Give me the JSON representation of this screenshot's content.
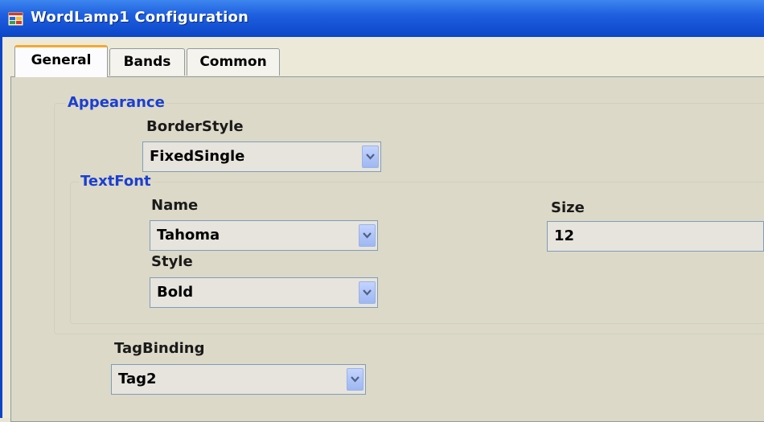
{
  "window": {
    "title": "WordLamp1 Configuration",
    "icon": "app-window-icon"
  },
  "tabs": [
    {
      "label": "General",
      "active": true
    },
    {
      "label": "Bands",
      "active": false
    },
    {
      "label": "Common",
      "active": false
    }
  ],
  "appearance": {
    "legend": "Appearance",
    "border_style": {
      "label": "BorderStyle",
      "value": "FixedSingle"
    },
    "text_font": {
      "legend": "TextFont",
      "name": {
        "label": "Name",
        "value": "Tahoma"
      },
      "size": {
        "label": "Size",
        "value": "12"
      },
      "style": {
        "label": "Style",
        "value": "Bold"
      }
    }
  },
  "tag_binding": {
    "label": "TagBinding",
    "value": "Tag2"
  },
  "colors": {
    "titlebar": "#0b46c8",
    "legend_text": "#1b3fd1",
    "active_tab_accent": "#f4a832",
    "panel_bg": "#dcd9c8"
  }
}
